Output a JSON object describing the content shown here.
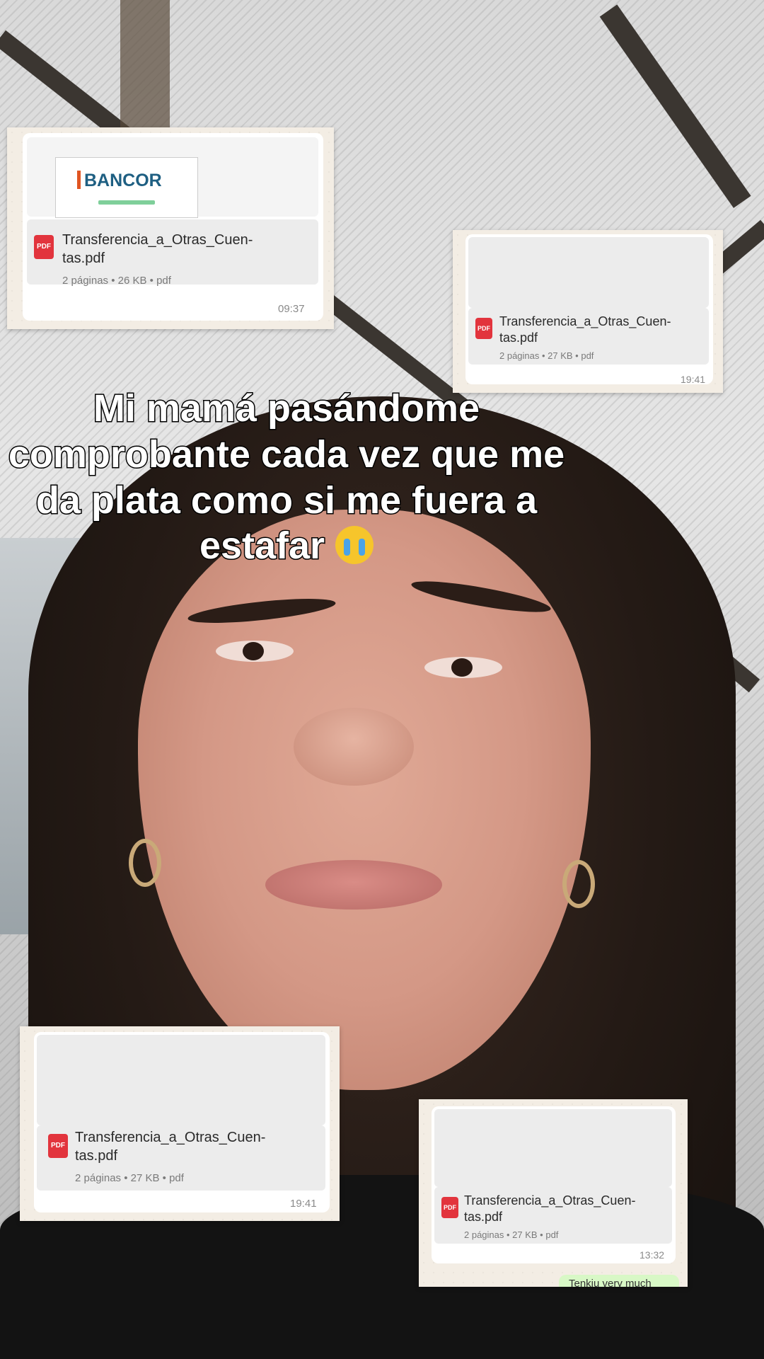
{
  "caption": {
    "text": "Mi mamá pasándome comprobante cada vez que me da plata como si me fuera a estafar",
    "emoji": "loudly-crying-face-emoji"
  },
  "cards": [
    {
      "bank_logo": "BANCOR",
      "file_name": "Transferencia_a_Otras_Cuen-tas.pdf",
      "meta": "2 páginas • 26 KB • pdf",
      "time": "09:37",
      "icon_label": "PDF"
    },
    {
      "file_name": "Transferencia_a_Otras_Cuen-tas.pdf",
      "meta": "2 páginas • 27 KB • pdf",
      "time": "19:41",
      "icon_label": "PDF"
    },
    {
      "file_name": "Transferencia_a_Otras_Cuen-tas.pdf",
      "meta": "2 páginas • 27 KB • pdf",
      "time": "19:41",
      "icon_label": "PDF"
    },
    {
      "file_name": "Transferencia_a_Otras_Cuen-tas.pdf",
      "meta": "2 páginas • 27 KB • pdf",
      "time": "13:32",
      "icon_label": "PDF",
      "reply_text": "Tenkiu very much"
    }
  ],
  "colors": {
    "pdf_icon": "#e2343d",
    "outgoing_bubble": "#d8f8c6",
    "bancor_blue": "#1e5f82"
  }
}
